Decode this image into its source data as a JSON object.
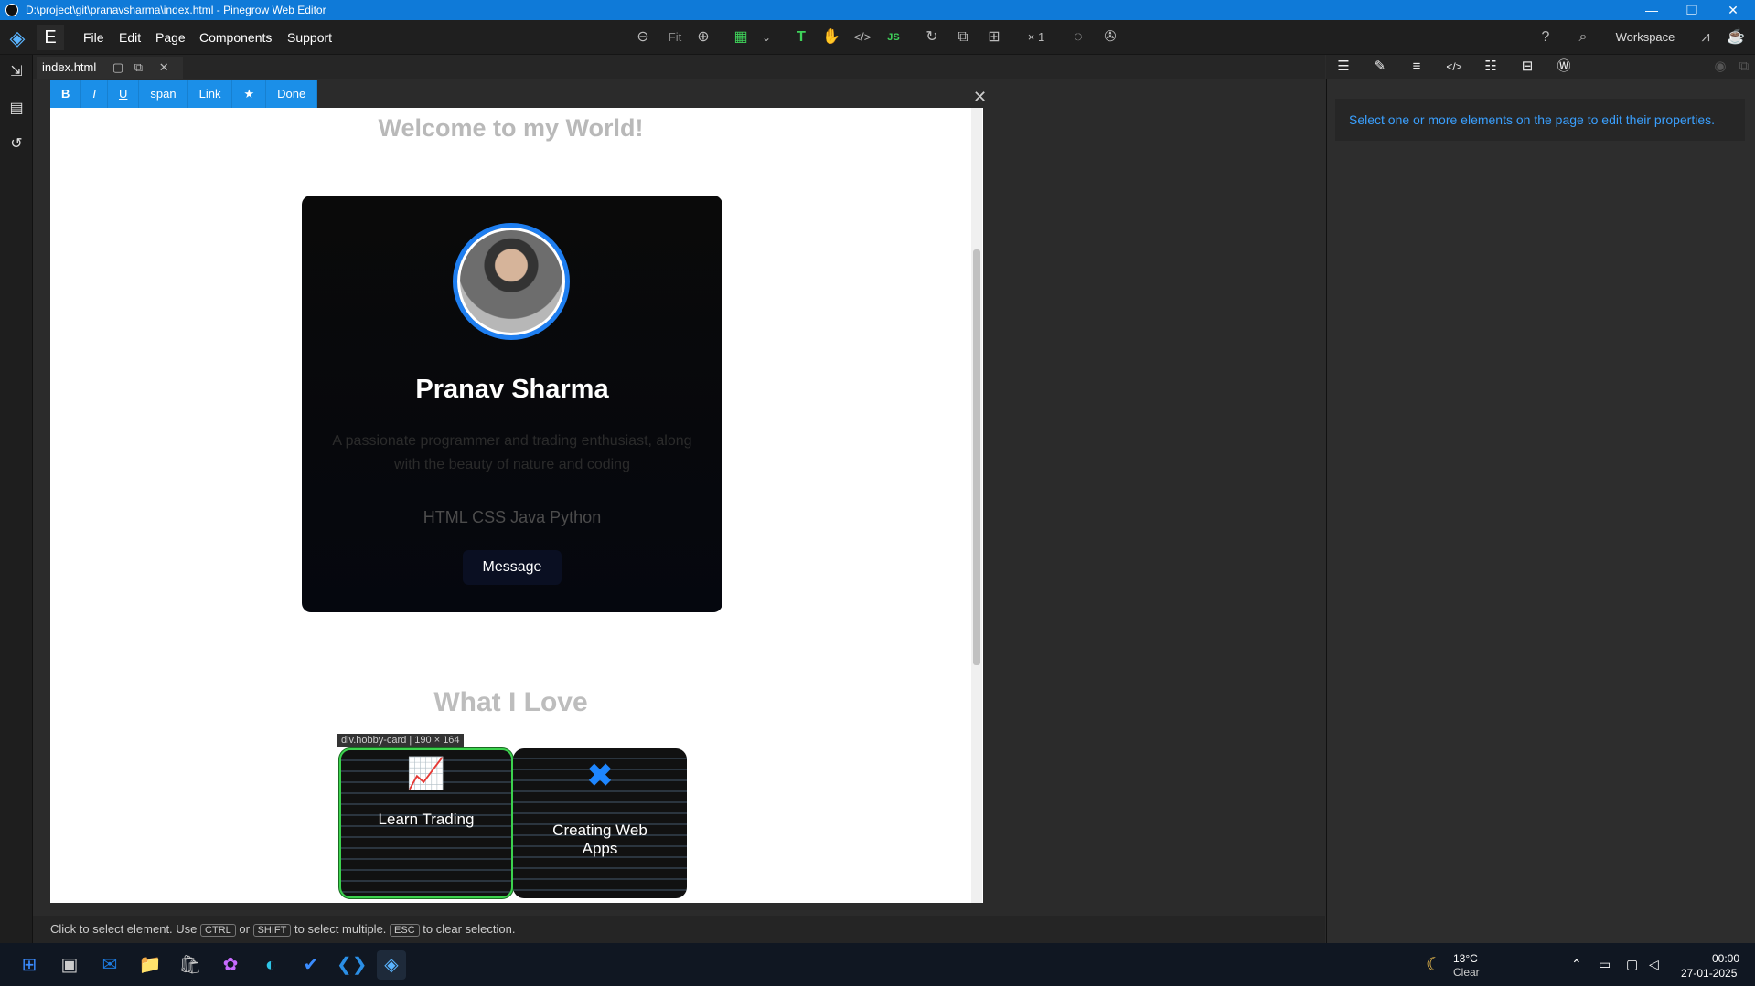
{
  "window": {
    "title": "D:\\project\\git\\pranavsharma\\index.html - Pinegrow Web Editor",
    "minimize": "—",
    "restore": "❐",
    "close": "✕"
  },
  "menu": {
    "file": "File",
    "edit": "Edit",
    "page": "Page",
    "components": "Components",
    "support": "Support",
    "e_label": "E"
  },
  "toolbar": {
    "fit": "Fit",
    "zoom_multiplier": "× 1",
    "workspace": "Workspace"
  },
  "tab": {
    "filename": "index.html"
  },
  "rte": [
    "B",
    "I",
    "U",
    "span",
    "Link",
    "★",
    "Done"
  ],
  "page": {
    "welcome": "Welcome to my World!",
    "name": "Pranav Sharma",
    "bio": "A passionate programmer and trading enthusiast, along with the beauty of nature and coding",
    "skills": "HTML  CSS  Java  Python",
    "message_button": "Message",
    "section_title": "What I Love",
    "selection_badge": "div.hobby-card | 190 × 164",
    "hobbies": [
      {
        "label": "Learn Trading",
        "icon": "chart-line-icon"
      },
      {
        "label": "Creating Web Apps",
        "icon": "tools-icon"
      }
    ]
  },
  "status": {
    "pre": "Click to select element. Use",
    "ctrl": "CTRL",
    "or": "or",
    "shift": "SHIFT",
    "mid": "to select multiple.",
    "esc": "ESC",
    "post": "to clear selection."
  },
  "rightpanel": {
    "message": "Select one or more elements on the page to edit their properties."
  },
  "taskbar": {
    "temp": "13°C",
    "weather": "Clear",
    "time": "00:00",
    "date": "27-01-2025"
  }
}
